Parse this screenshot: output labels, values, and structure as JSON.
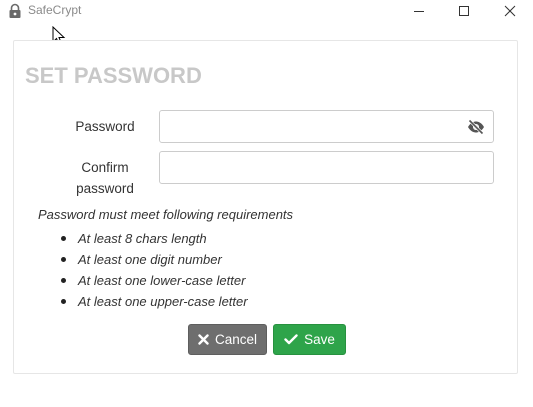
{
  "window": {
    "title": "SafeCrypt",
    "app_icon": "lock-icon",
    "controls": [
      "minimize-icon",
      "maximize-icon",
      "close-icon"
    ]
  },
  "form": {
    "heading": "SET PASSWORD",
    "password_label": "Password",
    "password_value": "",
    "password_placeholder": "",
    "password_toggle_icon": "eye-slash-icon",
    "confirm_label": "Confirm password",
    "confirm_value": "",
    "confirm_placeholder": ""
  },
  "requirements": {
    "title": "Password must meet following requirements",
    "items": [
      "At least 8 chars length",
      "At least one digit number",
      "At least one lower-case letter",
      "At least one upper-case letter"
    ]
  },
  "buttons": {
    "cancel_label": "Cancel",
    "cancel_icon": "times-icon",
    "save_label": "Save",
    "save_icon": "check-icon"
  },
  "colors": {
    "heading": "#c8c8c8",
    "cancel": "#6e6e6e",
    "save": "#2ea44a"
  }
}
